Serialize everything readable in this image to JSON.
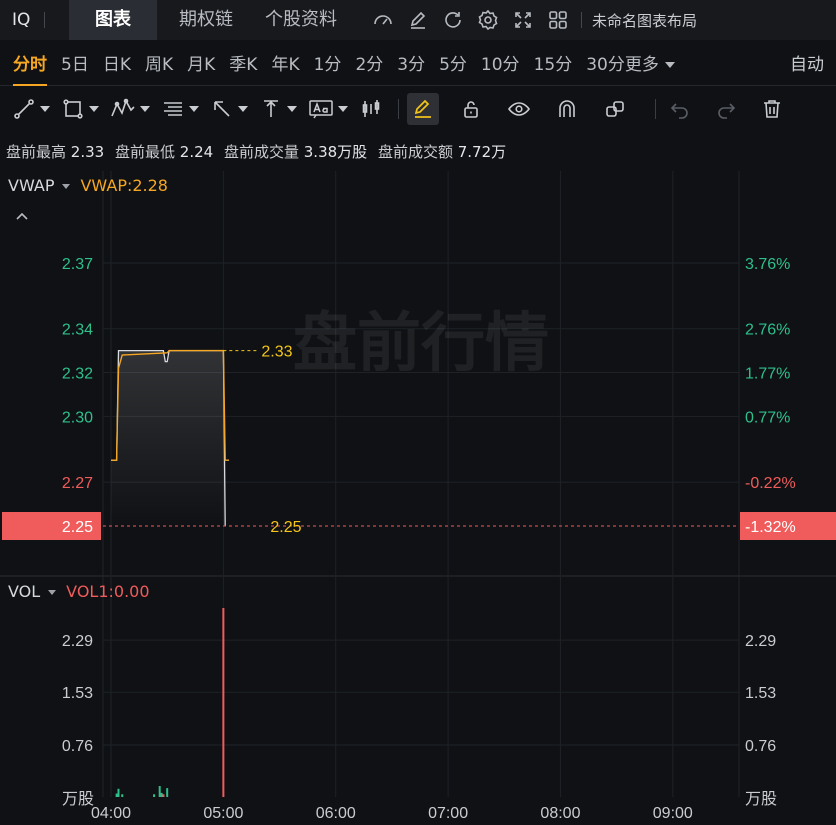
{
  "topbar": {
    "symbol": "IQ",
    "tabs": [
      "图表",
      "期权链",
      "个股资料"
    ],
    "active_tab": 0,
    "icons": [
      "indicator-icon",
      "edit-icon",
      "refresh-icon",
      "settings-icon",
      "fullscreen-icon",
      "grid-layout-icon"
    ],
    "layout_name": "未命名图表布局"
  },
  "periodbar": {
    "periods": [
      "分时",
      "5日",
      "日K",
      "周K",
      "月K",
      "季K",
      "年K",
      "1分",
      "2分",
      "3分",
      "5分",
      "10分",
      "15分",
      "30分"
    ],
    "active_period": 0,
    "more_label": "更多",
    "auto_label": "自动"
  },
  "drawbar": {
    "tools": [
      "line-tool-icon",
      "rectangle-tool-icon",
      "pattern-tool-icon",
      "fibonacci-tool-icon",
      "arrow-tool-icon",
      "measure-tool-icon",
      "text-tool-icon",
      "bar-tool-icon"
    ],
    "buttons": [
      "pencil-icon",
      "unlock-icon",
      "eye-icon",
      "magnet-icon",
      "link-icon",
      "undo-icon",
      "redo-icon",
      "trash-icon"
    ]
  },
  "stats": [
    {
      "label": "盘前最高",
      "value": "2.33"
    },
    {
      "label": "盘前最低",
      "value": "2.24"
    },
    {
      "label": "盘前成交量",
      "value": "3.38万股"
    },
    {
      "label": "盘前成交额",
      "value": "7.72万"
    }
  ],
  "colors": {
    "up": "#2ec08b",
    "down": "#f05b5b",
    "vwap": "#f5a623",
    "price_line": "#d9dbe0",
    "current_price_bg": "#f05b5b",
    "background": "#0f1114",
    "grid": "#1f2227"
  },
  "chart_data": {
    "type": "line",
    "watermark": "盘前行情",
    "price_panel": {
      "indicator_name": "VWAP",
      "indicator_value_label": "VWAP:2.28",
      "y_ticks_left": [
        "2.37",
        "2.34",
        "2.32",
        "2.30",
        "2.27"
      ],
      "y_ticks_right": [
        "3.76%",
        "2.76%",
        "1.77%",
        "0.77%",
        "-0.22%"
      ],
      "current_price": "2.25",
      "current_pct": "-1.32%",
      "high_label": "2.33",
      "last_label": "2.25",
      "reference_price": 2.28,
      "ylim": [
        2.25,
        2.375
      ],
      "price_series": {
        "name": "",
        "x": [
          "04:00",
          "04:03",
          "04:04",
          "04:05",
          "04:28",
          "04:29",
          "04:30",
          "04:31",
          "05:00",
          "05:01"
        ],
        "values": [
          2.28,
          2.28,
          2.33,
          2.33,
          2.33,
          2.325,
          2.325,
          2.33,
          2.33,
          2.25
        ]
      },
      "vwap_series": {
        "name": "VWAP",
        "x": [
          "04:00",
          "04:03",
          "04:04",
          "04:06",
          "04:30",
          "04:31",
          "04:44",
          "05:00",
          "05:01",
          "05:03"
        ],
        "values": [
          2.28,
          2.28,
          2.322,
          2.328,
          2.329,
          2.33,
          2.33,
          2.33,
          2.28,
          2.28
        ]
      }
    },
    "volume_panel": {
      "indicator_name": "VOL",
      "indicator_value_label": "VOL1:0.00",
      "y_ticks": [
        "2.29",
        "1.53",
        "0.76"
      ],
      "unit": "万股",
      "ylim": [
        0,
        2.76
      ],
      "bars": [
        {
          "x": "04:03",
          "value": 0.05,
          "dir": "up"
        },
        {
          "x": "04:04",
          "value": 0.12,
          "dir": "up"
        },
        {
          "x": "04:06",
          "value": 0.04,
          "dir": "up"
        },
        {
          "x": "04:23",
          "value": 0.04,
          "dir": "up"
        },
        {
          "x": "04:26",
          "value": 0.16,
          "dir": "up"
        },
        {
          "x": "04:27",
          "value": 0.06,
          "dir": "up"
        },
        {
          "x": "04:28",
          "value": 0.04,
          "dir": "down"
        },
        {
          "x": "04:30",
          "value": 0.13,
          "dir": "up"
        },
        {
          "x": "05:00",
          "value": 2.76,
          "dir": "down"
        }
      ]
    },
    "x_ticks": [
      "04:00",
      "05:00",
      "06:00",
      "07:00",
      "08:00",
      "09:00"
    ],
    "xlim": [
      "04:00",
      "09:30"
    ]
  }
}
